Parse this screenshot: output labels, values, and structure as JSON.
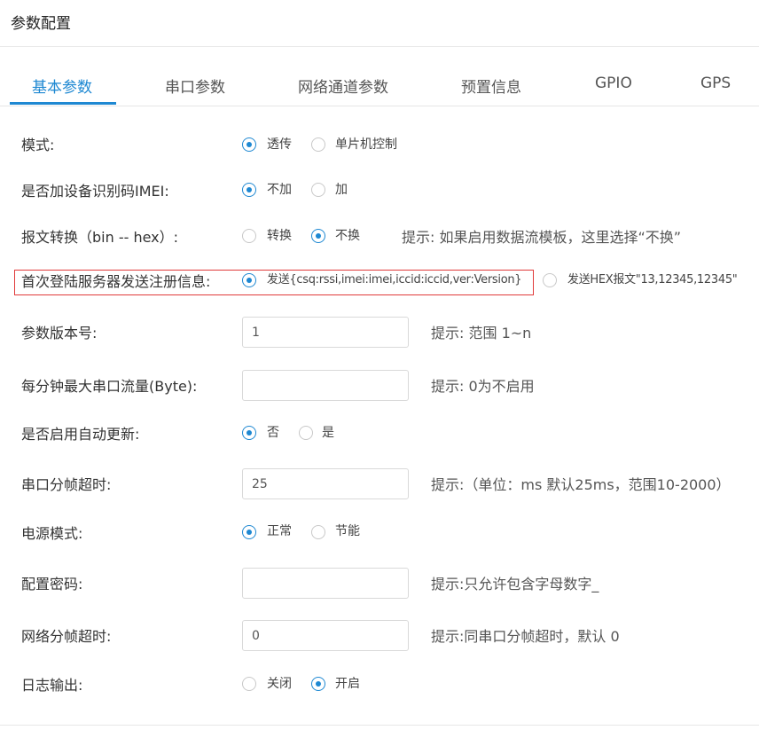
{
  "title": "参数配置",
  "tabs": [
    "基本参数",
    "串口参数",
    "网络通道参数",
    "预置信息",
    "GPIO",
    "GPS"
  ],
  "form": {
    "mode": {
      "label": "模式:",
      "options": [
        "透传",
        "单片机控制"
      ],
      "selected": "透传"
    },
    "imei": {
      "label": "是否加设备识别码IMEI:",
      "options": [
        "不加",
        "加"
      ],
      "selected": "不加"
    },
    "convert": {
      "label": "报文转换（bin -- hex）:",
      "options": [
        "转换",
        "不换"
      ],
      "selected": "不换",
      "hint": "提示: 如果启用数据流模板，这里选择“不换”"
    },
    "register": {
      "label": "首次登陆服务器发送注册信息:",
      "options": [
        "发送{csq:rssi,imei:imei,iccid:iccid,ver:Version}",
        "发送HEX报文\"13,12345,12345\""
      ],
      "selected": "发送{csq:rssi,imei:imei,iccid:iccid,ver:Version}"
    },
    "version": {
      "label": "参数版本号:",
      "value": "1",
      "hint": "提示: 范围 1~n"
    },
    "flow": {
      "label": "每分钟最大串口流量(Byte):",
      "value": "",
      "hint": "提示: 0为不启用"
    },
    "autoupdate": {
      "label": "是否启用自动更新:",
      "options": [
        "否",
        "是"
      ],
      "selected": "否"
    },
    "uart_timeout": {
      "label": "串口分帧超时:",
      "value": "25",
      "hint": "提示:（单位：ms 默认25ms，范围10-2000）"
    },
    "power": {
      "label": "电源模式:",
      "options": [
        "正常",
        "节能"
      ],
      "selected": "正常"
    },
    "password": {
      "label": "配置密码:",
      "value": "",
      "hint": "提示:只允许包含字母数字_"
    },
    "net_timeout": {
      "label": "网络分帧超时:",
      "value": "0",
      "hint": "提示:同串口分帧超时，默认 0"
    },
    "log": {
      "label": "日志输出:",
      "options": [
        "关闭",
        "开启"
      ],
      "selected": "开启"
    }
  },
  "colors": {
    "accent": "#1e88d2",
    "highlight_border": "#e03a3a"
  }
}
